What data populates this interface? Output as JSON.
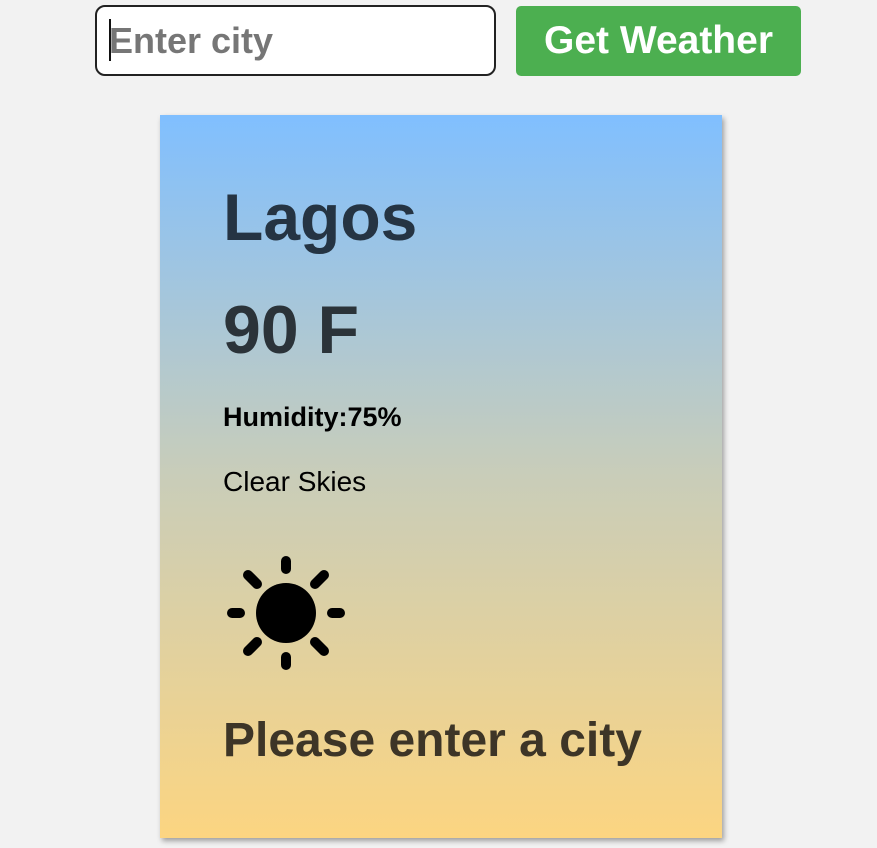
{
  "search": {
    "placeholder": "Enter city",
    "value": "",
    "button_label": "Get Weather"
  },
  "weather": {
    "city": "Lagos",
    "temperature": "90 F",
    "humidity": "Humidity:75%",
    "description": "Clear Skies",
    "icon": "sun-icon",
    "message": "Please enter a city"
  },
  "colors": {
    "page_background": "#f2f2f2",
    "button_background": "#4caf50",
    "card_gradient_top": "#80bfff",
    "card_gradient_bottom": "#fcd581"
  }
}
